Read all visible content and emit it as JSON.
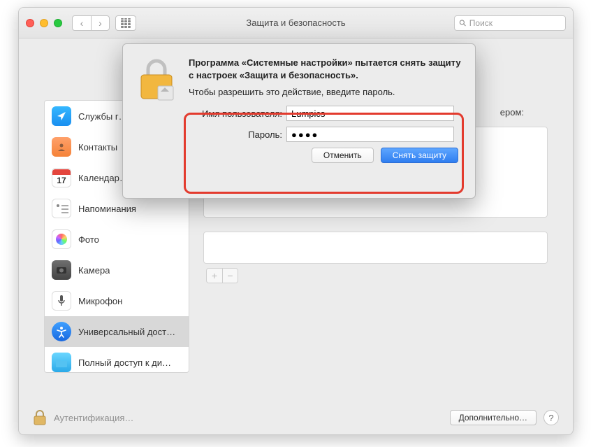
{
  "window": {
    "title": "Защита и безопасность",
    "search_placeholder": "Поиск"
  },
  "sidebar": {
    "items": [
      {
        "label": "Службы г…",
        "icon": "loc"
      },
      {
        "label": "Контакты",
        "icon": "cont"
      },
      {
        "label": "Календар…",
        "icon": "cal",
        "cal_num": "17"
      },
      {
        "label": "Напоминания",
        "icon": "rem"
      },
      {
        "label": "Фото",
        "icon": "photo"
      },
      {
        "label": "Камера",
        "icon": "cam"
      },
      {
        "label": "Микрофон",
        "icon": "mic"
      },
      {
        "label": "Универсальный дост…",
        "icon": "acc",
        "selected": true
      },
      {
        "label": "Полный доступ к ди…",
        "icon": "disk"
      }
    ]
  },
  "content": {
    "fragment_text": "ером:"
  },
  "footer": {
    "auth_text": "Аутентификация…",
    "advanced_label": "Дополнительно…",
    "help_label": "?"
  },
  "modal": {
    "heading": "Программа «Системные настройки» пытается снять защиту с настроек «Защита и безопасность».",
    "subtext": "Чтобы разрешить это действие, введите пароль.",
    "username_label": "Имя пользователя:",
    "username_value": "Lumpics",
    "password_label": "Пароль:",
    "password_value": "●●●●",
    "cancel_label": "Отменить",
    "unlock_label": "Снять защиту"
  }
}
